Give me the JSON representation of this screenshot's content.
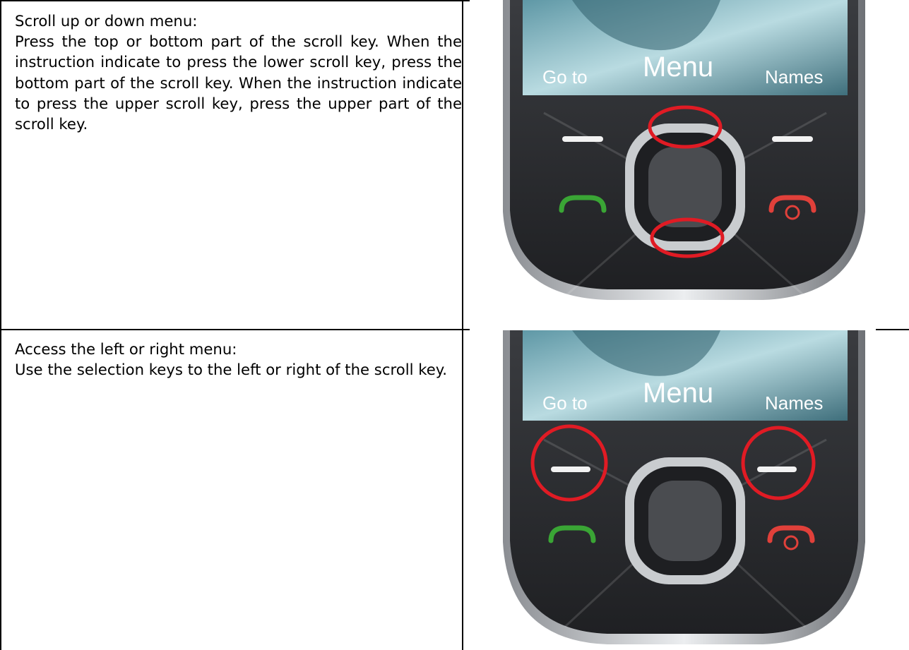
{
  "instructions": [
    {
      "heading": "Scroll up or down menu:",
      "body": "Press the top or bottom part of the scroll key. When the instruction indicate to press the lower scroll key, press the bottom part of the scroll key. When the instruction indicate to press the upper scroll key, press the upper part of the scroll key.",
      "highlight": "scroll-key-top-and-bottom"
    },
    {
      "heading": "Access the left or right menu:",
      "body": "Use the selection keys to the left or right of the scroll key.",
      "highlight": "left-and-right-selection-keys"
    }
  ],
  "phone_screen": {
    "left_softkey": "Go to",
    "center_softkey": "Menu",
    "right_softkey": "Names"
  },
  "colors": {
    "highlight_ring": "#e01b24",
    "call_key": "#3aa535",
    "end_key": "#e0403a",
    "phone_body": "#2e3033",
    "screen": "#9cc3cc"
  },
  "icons": [
    "call-key-icon",
    "end-key-icon",
    "scroll-key-icon",
    "selection-key-icon"
  ]
}
